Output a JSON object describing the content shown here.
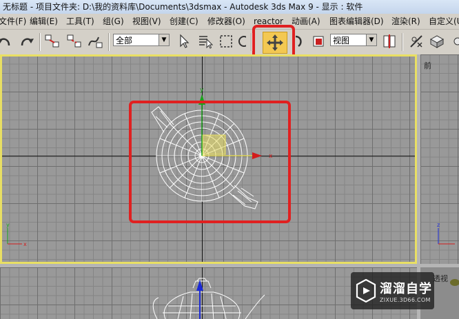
{
  "window": {
    "title": "无标题    - 项目文件夹: D:\\我的资料库\\Documents\\3dsmax    - Autodesk 3ds Max 9    - 显示 : 软件"
  },
  "menubar": {
    "items": [
      "文件(F)",
      "编辑(E)",
      "工具(T)",
      "组(G)",
      "视图(V)",
      "创建(C)",
      "修改器(O)",
      "reactor",
      "动画(A)",
      "图表编辑器(D)",
      "渲染(R)",
      "自定义(U"
    ]
  },
  "toolbar": {
    "selection_filter": "全部",
    "reference_coord": "视图",
    "active_tool": "select-and-move"
  },
  "viewports": {
    "top_right_label": "前",
    "bottom_right_label": "透视"
  },
  "watermark": {
    "name": "溜溜自学",
    "url": "ZIXUE.3D66.COM"
  },
  "colors": {
    "active_viewport_border": "#e9df63",
    "highlight_frame": "#e02020",
    "move_tool_active": "#f3c852",
    "gizmo_x": "#d21c1c",
    "gizmo_y": "#1aa31a",
    "gizmo_z": "#1b2ad6"
  }
}
